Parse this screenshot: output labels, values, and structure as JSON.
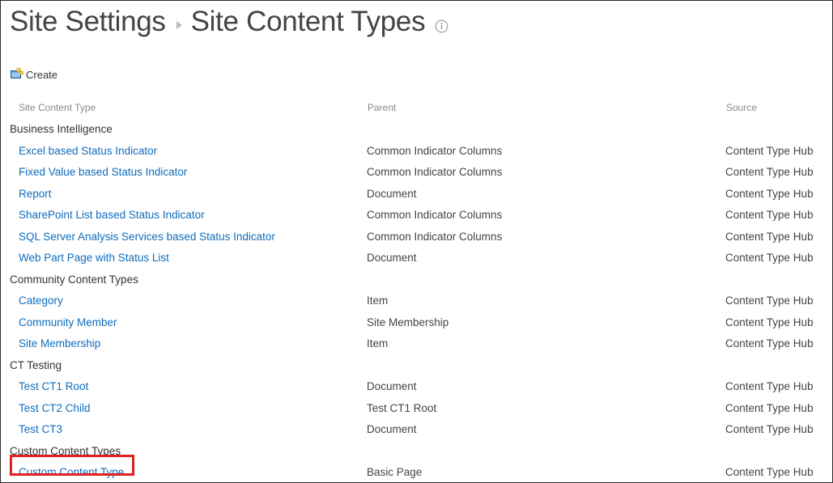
{
  "page": {
    "breadcrumb": [
      {
        "label": "Site Settings"
      },
      {
        "label": "Site Content Types"
      }
    ],
    "info_icon": "info-icon",
    "separator_icon": "chevron-right-icon"
  },
  "toolbar": {
    "create_label": "Create",
    "create_icon": "new-item-icon"
  },
  "table": {
    "columns": [
      {
        "key": "name",
        "label": "Site Content Type"
      },
      {
        "key": "parent",
        "label": "Parent"
      },
      {
        "key": "source",
        "label": "Source"
      }
    ],
    "rows": [
      {
        "type": "group",
        "name": "Business Intelligence",
        "parent": "",
        "source": ""
      },
      {
        "type": "item",
        "name": "Excel based Status Indicator",
        "parent": "Common Indicator Columns",
        "source": "Content Type Hub"
      },
      {
        "type": "item",
        "name": "Fixed Value based Status Indicator",
        "parent": "Common Indicator Columns",
        "source": "Content Type Hub"
      },
      {
        "type": "item",
        "name": "Report",
        "parent": "Document",
        "source": "Content Type Hub"
      },
      {
        "type": "item",
        "name": "SharePoint List based Status Indicator",
        "parent": "Common Indicator Columns",
        "source": "Content Type Hub"
      },
      {
        "type": "item",
        "name": "SQL Server Analysis Services based Status Indicator",
        "parent": "Common Indicator Columns",
        "source": "Content Type Hub"
      },
      {
        "type": "item",
        "name": "Web Part Page with Status List",
        "parent": "Document",
        "source": "Content Type Hub"
      },
      {
        "type": "group",
        "name": "Community Content Types",
        "parent": "",
        "source": ""
      },
      {
        "type": "item",
        "name": "Category",
        "parent": "Item",
        "source": "Content Type Hub"
      },
      {
        "type": "item",
        "name": "Community Member",
        "parent": "Site Membership",
        "source": "Content Type Hub"
      },
      {
        "type": "item",
        "name": "Site Membership",
        "parent": "Item",
        "source": "Content Type Hub"
      },
      {
        "type": "group",
        "name": "CT Testing",
        "parent": "",
        "source": ""
      },
      {
        "type": "item",
        "name": "Test CT1 Root",
        "parent": "Document",
        "source": "Content Type Hub"
      },
      {
        "type": "item",
        "name": "Test CT2 Child",
        "parent": "Test CT1 Root",
        "source": "Content Type Hub"
      },
      {
        "type": "item",
        "name": "Test CT3",
        "parent": "Document",
        "source": "Content Type Hub"
      },
      {
        "type": "group",
        "name": "Custom Content Types",
        "parent": "",
        "source": ""
      },
      {
        "type": "item",
        "name": "Custom Content Type",
        "parent": "Basic Page",
        "source": "Content Type Hub",
        "highlighted": true
      }
    ]
  },
  "colors": {
    "link": "#0f6cbd",
    "text": "#444444",
    "header_text": "#898989",
    "highlight": "#e02020"
  }
}
